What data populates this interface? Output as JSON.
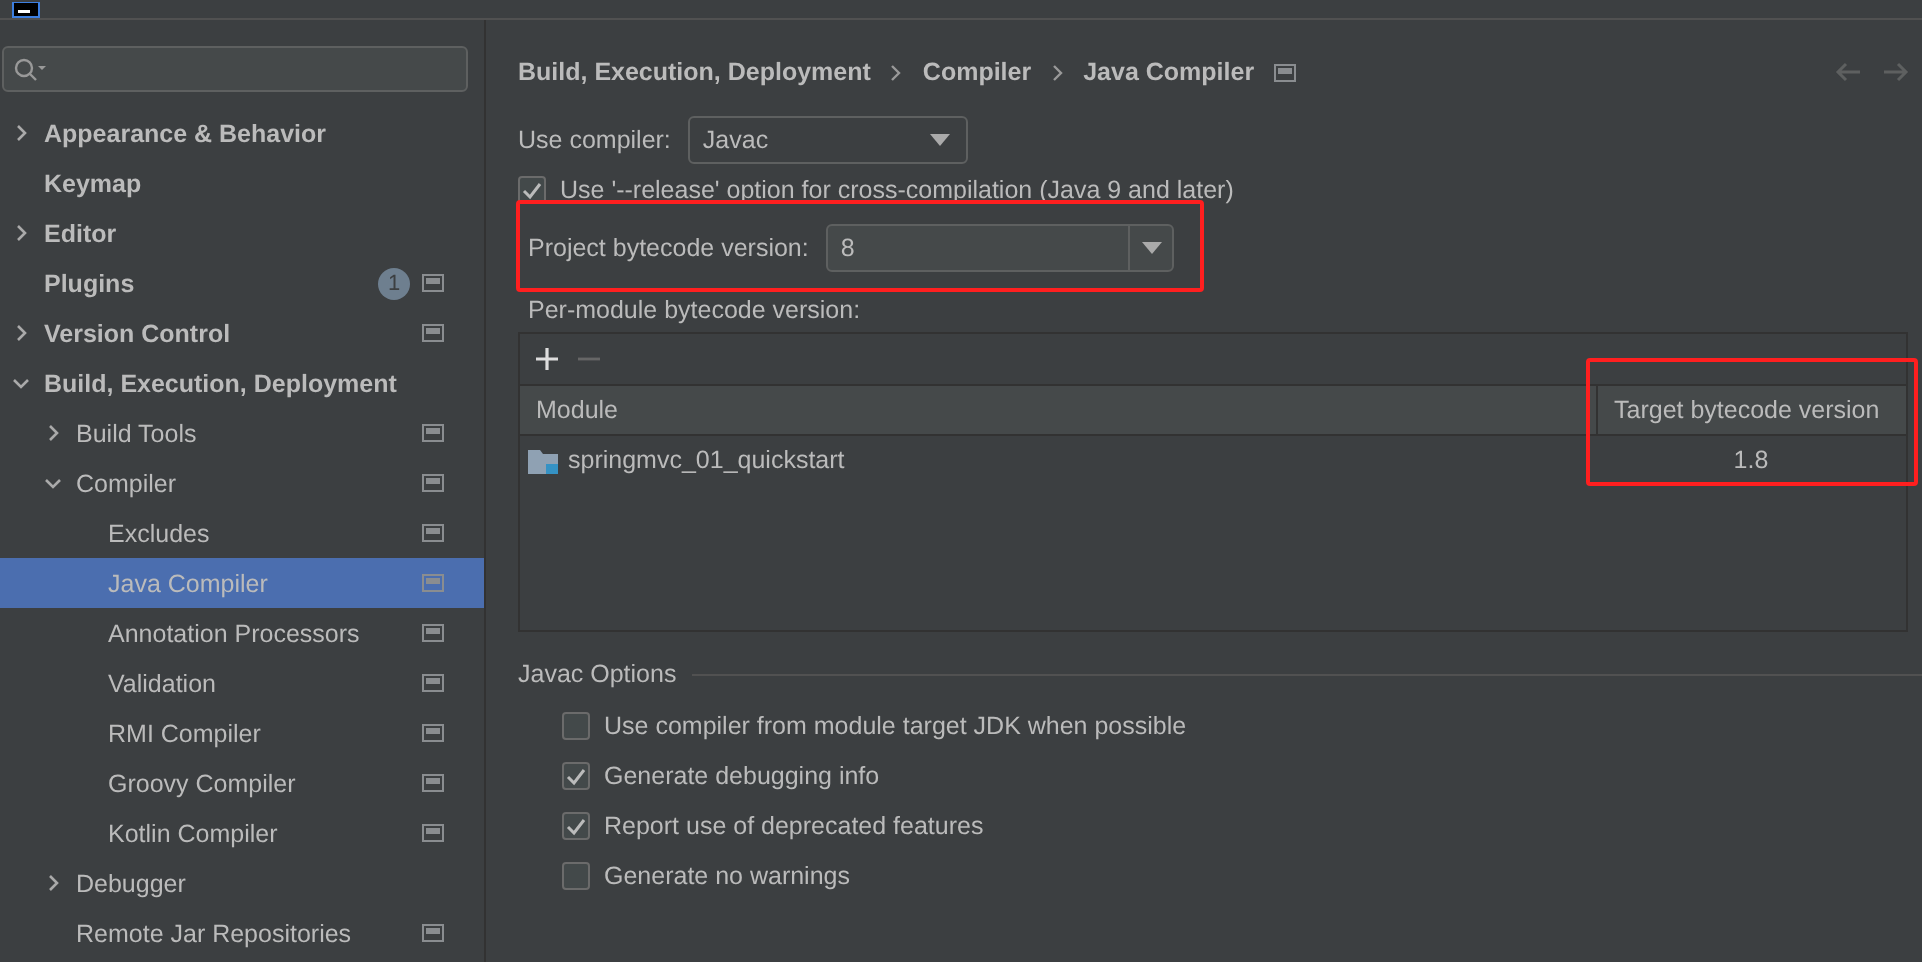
{
  "sidebar": {
    "items": [
      {
        "label": "Appearance & Behavior",
        "expanded": false
      },
      {
        "label": "Keymap"
      },
      {
        "label": "Editor",
        "expanded": false
      },
      {
        "label": "Plugins",
        "badge": "1",
        "project_icon": true
      },
      {
        "label": "Version Control",
        "expanded": false,
        "project_icon": true
      },
      {
        "label": "Build, Execution, Deployment",
        "expanded": true,
        "children": [
          {
            "label": "Build Tools",
            "expanded": false,
            "project_icon": true
          },
          {
            "label": "Compiler",
            "expanded": true,
            "project_icon": true,
            "children": [
              {
                "label": "Excludes",
                "project_icon": true,
                "selected": false
              },
              {
                "label": "Java Compiler",
                "project_icon": true,
                "selected": true
              },
              {
                "label": "Annotation Processors",
                "project_icon": true,
                "selected": false
              },
              {
                "label": "Validation",
                "project_icon": true,
                "selected": false
              },
              {
                "label": "RMI Compiler",
                "project_icon": true,
                "selected": false
              },
              {
                "label": "Groovy Compiler",
                "project_icon": true,
                "selected": false
              },
              {
                "label": "Kotlin Compiler",
                "project_icon": true,
                "selected": false
              }
            ]
          },
          {
            "label": "Debugger",
            "expanded": false
          },
          {
            "label": "Remote Jar Repositories",
            "project_icon": true
          }
        ]
      }
    ]
  },
  "breadcrumb": [
    "Build, Execution, Deployment",
    "Compiler",
    "Java Compiler"
  ],
  "use_compiler": {
    "label": "Use compiler:",
    "value": "Javac"
  },
  "release_option": {
    "label": "Use '--release' option for cross-compilation (Java 9 and later)",
    "checked": true
  },
  "project_bytecode": {
    "label": "Project bytecode version:",
    "value": "8",
    "highlighted": true
  },
  "per_module": {
    "label": "Per-module bytecode version:",
    "table": {
      "columns": [
        {
          "label": "Module",
          "highlighted": false
        },
        {
          "label": "Target bytecode version",
          "highlighted": true
        }
      ],
      "rows": [
        {
          "module": "springmvc_01_quickstart",
          "target": "1.8"
        }
      ]
    }
  },
  "javac_options": {
    "title": "Javac Options",
    "options": [
      {
        "label": "Use compiler from module target JDK when possible",
        "checked": false
      },
      {
        "label": "Generate debugging info",
        "checked": true
      },
      {
        "label": "Report use of deprecated features",
        "checked": true
      },
      {
        "label": "Generate no warnings",
        "checked": false
      }
    ]
  }
}
